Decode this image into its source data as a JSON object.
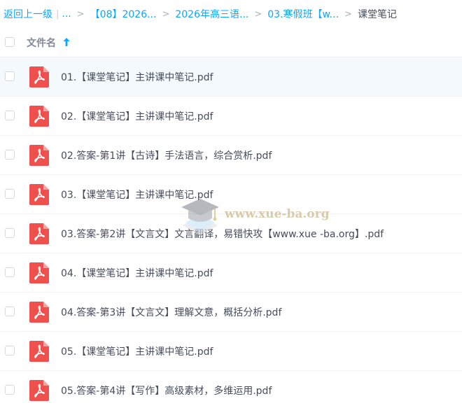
{
  "breadcrumb": {
    "back": "返回上一级",
    "ellipsis": "...",
    "separator": ">",
    "items": [
      "【08】2026...",
      "2026年高三语...",
      "03.寒假班【w..."
    ],
    "current": "课堂笔记"
  },
  "header": {
    "name_label": "文件名",
    "sort": "ascending"
  },
  "files": [
    {
      "name": "01.【课堂笔记】主讲课中笔记.pdf",
      "type": "pdf"
    },
    {
      "name": "02.【课堂笔记】主讲课中笔记.pdf",
      "type": "pdf"
    },
    {
      "name": "02.答案-第1讲【古诗】手法语言，综合赏析.pdf",
      "type": "pdf"
    },
    {
      "name": "03.【课堂笔记】主讲课中笔记.pdf",
      "type": "pdf"
    },
    {
      "name": "03.答案-第2讲【文言文】文言翻译，易错快攻【www.xue -ba.org】.pdf",
      "type": "pdf"
    },
    {
      "name": "04.【课堂笔记】主讲课中笔记.pdf",
      "type": "pdf"
    },
    {
      "name": "04.答案-第3讲【文言文】理解文意，概括分析.pdf",
      "type": "pdf"
    },
    {
      "name": "05.【课堂笔记】主讲课中笔记.pdf",
      "type": "pdf"
    },
    {
      "name": "05.答案-第4讲【写作】高级素材，多维运用.pdf",
      "type": "pdf"
    }
  ],
  "watermark": {
    "text": "www.xue-ba.org",
    "icon": "graduation-cap-logo"
  },
  "colors": {
    "link": "#06a7ff",
    "text": "#454d5a",
    "header_text": "#818999",
    "pdf_red": "#f0504d",
    "row_hover": "#f4f9fd"
  }
}
